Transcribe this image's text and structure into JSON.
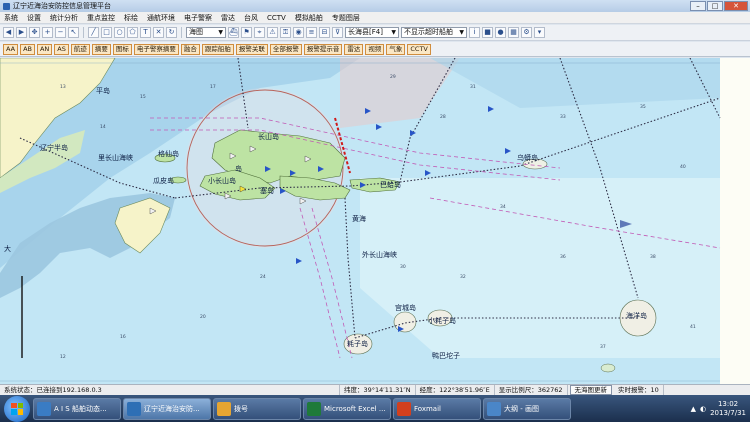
{
  "window": {
    "title": "辽宁近海治安防控信息管理平台",
    "controls": [
      "–",
      "□",
      "✕"
    ]
  },
  "menu": [
    "系统",
    "设置",
    "统计分析",
    "重点监控",
    "标绘",
    "通航环境",
    "电子警察",
    "雷达",
    "台风",
    "CCTV",
    "模拟船舶",
    "专题图层"
  ],
  "toolbar1": {
    "layer_select": "海图",
    "region_select": "长海县[F4]",
    "timeout_select": "不显示超时船舶"
  },
  "toolbar2": {
    "buttons": [
      "AA",
      "AB",
      "AN",
      "AS",
      "航迹",
      "摘要",
      "图标",
      "电子警察摘要",
      "融合",
      "跟踪船舶",
      "报警关联",
      "全部报警",
      "报警提示音",
      "雷达",
      "视频",
      "气象",
      "CCTV"
    ]
  },
  "map": {
    "labels": [
      {
        "text": "平岛"
      },
      {
        "text": "长山岛"
      },
      {
        "text": "辽宁半岛"
      },
      {
        "text": "里长山海峡"
      },
      {
        "text": "格仙岛"
      },
      {
        "text": "瓜皮岛"
      },
      {
        "text": "小长山岛"
      },
      {
        "text": "塞岛"
      },
      {
        "text": "巴蛤岛"
      },
      {
        "text": "乌蟒岛"
      },
      {
        "text": "黄海"
      },
      {
        "text": "外长山海峡"
      },
      {
        "text": "宫城岛"
      },
      {
        "text": "小耗子岛"
      },
      {
        "text": "耗子岛"
      },
      {
        "text": "鸭巴坨子"
      },
      {
        "text": "海洋岛"
      },
      {
        "text": "岛"
      },
      {
        "text": "大"
      }
    ]
  },
  "status": {
    "connection": "系统状态：已连接到192.168.0.3",
    "latitude": "纬度：39°14′11.31″N",
    "longitude": "经度：122°38′51.96″E",
    "scale": "显示比例尺：362762",
    "update_btn": "无海图更新",
    "alarm": "实时报警：10"
  },
  "taskbar": {
    "tasks": [
      {
        "label": "A I S 船舶动态...",
        "color": "#3a7cc4"
      },
      {
        "label": "辽宁近海治安防...",
        "color": "#2e6fb5"
      },
      {
        "label": "拨号",
        "color": "#e6a532"
      },
      {
        "label": "Microsoft Excel ...",
        "color": "#1f7a3a"
      },
      {
        "label": "Foxmail",
        "color": "#d2401e"
      },
      {
        "label": "大纲 - 画图",
        "color": "#4a86c8"
      }
    ],
    "clock_time": "13:02",
    "clock_date": "2013/7/31"
  }
}
